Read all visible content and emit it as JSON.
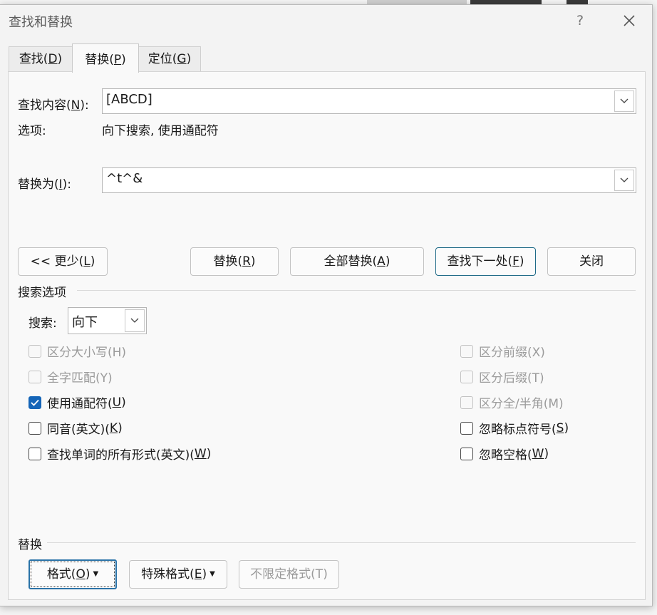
{
  "dialog": {
    "title": "查找和替换",
    "help_glyph": "?"
  },
  "tabs": [
    {
      "label": "查找(",
      "key": "D",
      "tail": ")"
    },
    {
      "label": "替换(",
      "key": "P",
      "tail": ")"
    },
    {
      "label": "定位(",
      "key": "G",
      "tail": ")"
    }
  ],
  "find": {
    "label": "查找内容(",
    "key": "N",
    "tail": "):",
    "value": "[ABCD]"
  },
  "options": {
    "label": "选项:",
    "value": "向下搜索, 使用通配符"
  },
  "replace": {
    "label": "替换为(",
    "key": "I",
    "tail": "):",
    "value": "^t^&"
  },
  "buttons": {
    "less": {
      "label": "<< 更少(",
      "key": "L",
      "tail": ")"
    },
    "replace": {
      "label": "替换(",
      "key": "R",
      "tail": ")"
    },
    "replace_all": {
      "label": "全部替换(",
      "key": "A",
      "tail": ")"
    },
    "find_next": {
      "label": "查找下一处(",
      "key": "F",
      "tail": ")"
    },
    "close": {
      "label": "关闭"
    }
  },
  "search_options": {
    "title": "搜索选项",
    "direction_label": "搜索:",
    "direction_value": "向下"
  },
  "checkboxes_left": [
    {
      "label": "区分大小写(H)",
      "checked": false,
      "disabled": true
    },
    {
      "label": "全字匹配(Y)",
      "checked": false,
      "disabled": true
    },
    {
      "label": "使用通配符(",
      "key": "U",
      "tail": ")",
      "checked": true,
      "disabled": false
    },
    {
      "label": "同音(英文)(",
      "key": "K",
      "tail": ")",
      "checked": false,
      "disabled": false
    },
    {
      "label": "查找单词的所有形式(英文)(",
      "key": "W",
      "tail": ")",
      "checked": false,
      "disabled": false
    }
  ],
  "checkboxes_right": [
    {
      "label": "区分前缀(X)",
      "checked": false,
      "disabled": true
    },
    {
      "label": "区分后缀(T)",
      "checked": false,
      "disabled": true
    },
    {
      "label": "区分全/半角(M)",
      "checked": false,
      "disabled": true
    },
    {
      "label": "忽略标点符号(",
      "key": "S",
      "tail": ")",
      "checked": false,
      "disabled": false
    },
    {
      "label": "忽略空格(",
      "key": "W",
      "tail": ")",
      "checked": false,
      "disabled": false
    }
  ],
  "replace_section": {
    "title": "替换",
    "format": {
      "label": "格式(",
      "key": "O",
      "tail": ")"
    },
    "special": {
      "label": "特殊格式(",
      "key": "E",
      "tail": ")"
    },
    "no_format": {
      "label": "不限定格式(T)"
    }
  },
  "colors": {
    "accent": "#1565b8",
    "primary_border": "#1f6a87"
  }
}
